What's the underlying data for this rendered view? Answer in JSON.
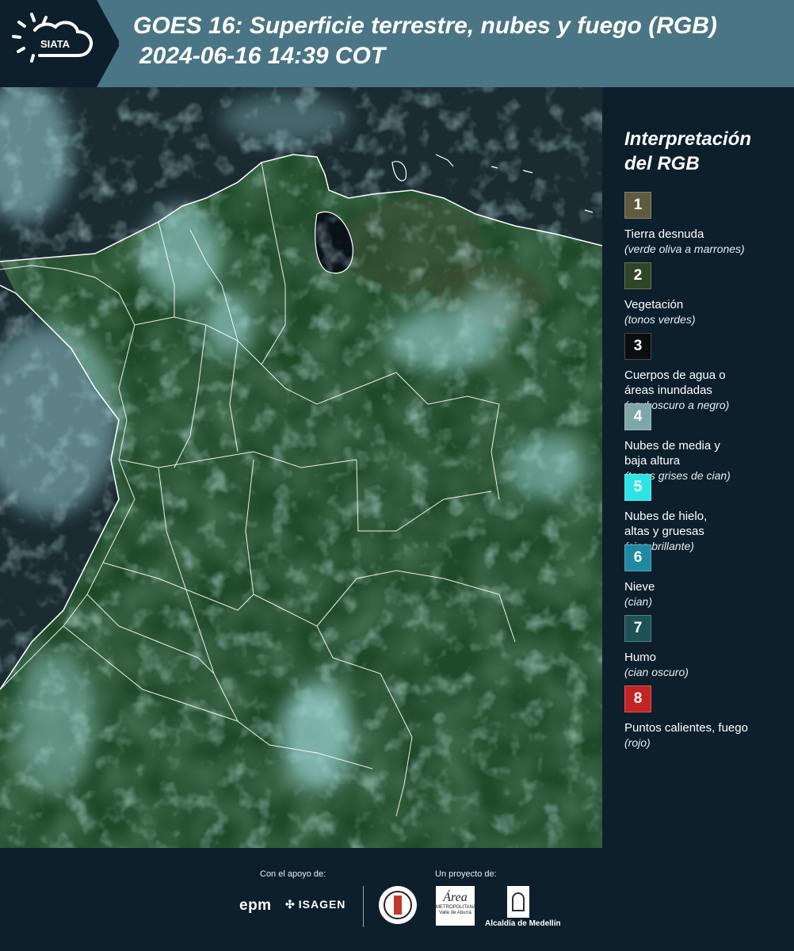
{
  "header": {
    "logo_text": "SIATA",
    "title_line1": "GOES 16: Superficie terrestre, nubes y fuego (RGB)",
    "title_line2": "2024-06-16 14:39 COT"
  },
  "legend": {
    "title_line1": "Interpretación",
    "title_line2": "del RGB",
    "items": [
      {
        "num": "1",
        "color": "#5e5b3f",
        "label": "Tierra desnuda",
        "sub": "(verde oliva a marrones)"
      },
      {
        "num": "2",
        "color": "#2f4626",
        "label": "Vegetación",
        "sub": "(tonos verdes)"
      },
      {
        "num": "3",
        "color": "#0b0d10",
        "label": "Cuerpos de agua o\náreas inundadas",
        "sub": "(azul oscuro a negro)"
      },
      {
        "num": "4",
        "color": "#7fa7a8",
        "label": "Nubes de media y\nbaja altura",
        "sub": "(tonos grises de cian)"
      },
      {
        "num": "5",
        "color": "#2ee3e6",
        "label": "Nubes de hielo,\naltas y gruesas",
        "sub": "(cian brillante)"
      },
      {
        "num": "6",
        "color": "#1f89a3",
        "label": "Nieve",
        "sub": "(cian)"
      },
      {
        "num": "7",
        "color": "#1e5257",
        "label": "Humo",
        "sub": "(cian oscuro)"
      },
      {
        "num": "8",
        "color": "#c42323",
        "label": "Puntos calientes, fuego",
        "sub": "(rojo)"
      }
    ]
  },
  "footer": {
    "support_label": "Con el apoyo de:",
    "project_label": "Un proyecto de:",
    "epm": "epm",
    "isagen": "ISAGEN",
    "metro_area": "Área",
    "metro_sub": "METROPOLITANA\nValle de Aburrá",
    "medellin": "Alcaldía de Medellín"
  }
}
